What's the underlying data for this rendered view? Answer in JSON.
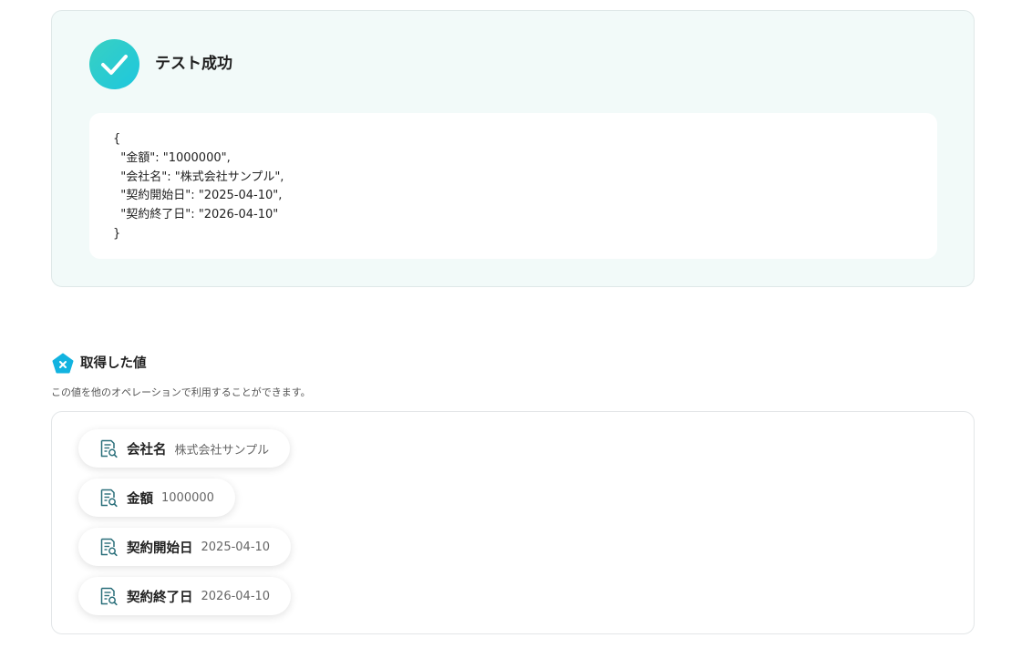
{
  "test_result": {
    "title": "テスト成功",
    "json_output": "{\n  \"金額\": \"1000000\",\n  \"会社名\": \"株式会社サンプル\",\n  \"契約開始日\": \"2025-04-10\",\n  \"契約終了日\": \"2026-04-10\"\n}",
    "accent_color": "#1ec7de"
  },
  "obtained_values": {
    "title": "取得した値",
    "description": "この値を他のオペレーションで利用することができます。",
    "icon": "variable-x-icon",
    "items": [
      {
        "name": "会社名",
        "value": "株式会社サンプル",
        "icon": "document-search-icon"
      },
      {
        "name": "金額",
        "value": "1000000",
        "icon": "document-search-icon"
      },
      {
        "name": "契約開始日",
        "value": "2025-04-10",
        "icon": "document-search-icon"
      },
      {
        "name": "契約終了日",
        "value": "2026-04-10",
        "icon": "document-search-icon"
      }
    ]
  }
}
